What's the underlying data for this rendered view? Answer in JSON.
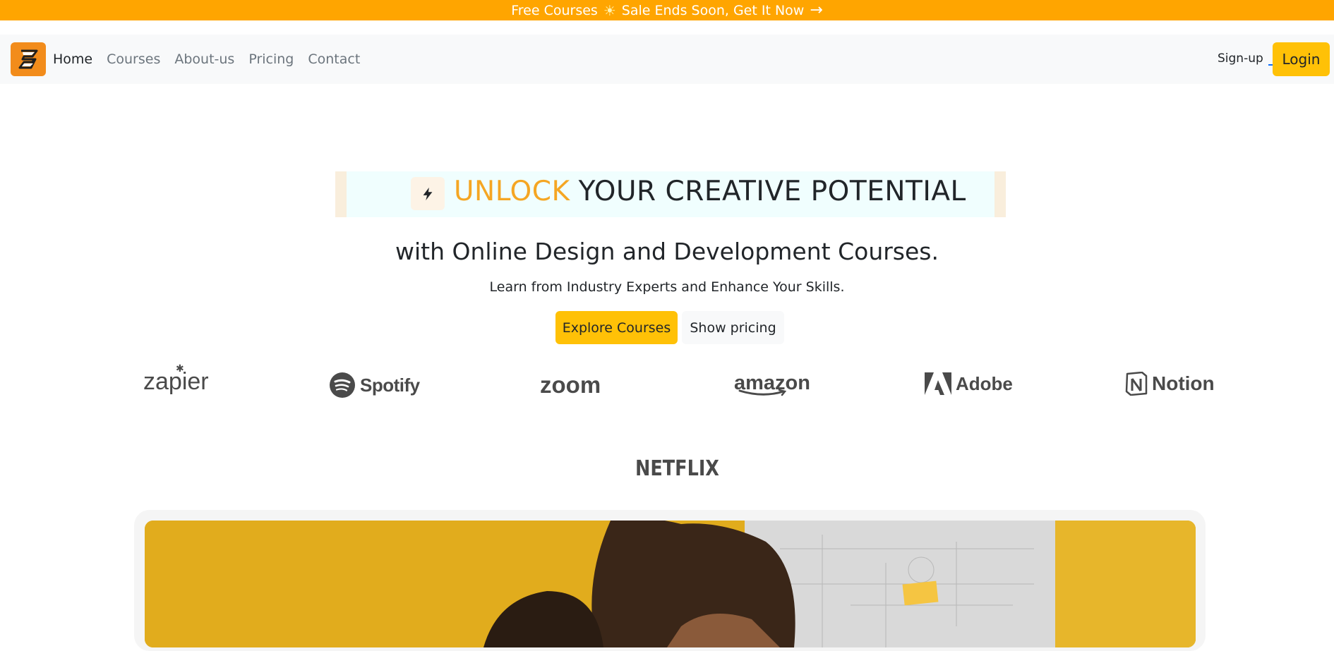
{
  "promo": {
    "part1": "Free Courses",
    "icon": "sun-icon",
    "part2": "Sale Ends Soon, Get It Now",
    "arrow_icon": "arrow-right-icon"
  },
  "navbar": {
    "logo_icon": "brand-logo-icon",
    "links": [
      "Home",
      "Courses",
      "About-us",
      "Pricing",
      "Contact"
    ],
    "active": "Home",
    "signup_label": "Sign-up",
    "login_label": "Login"
  },
  "hero": {
    "highlight": "UNLOCK",
    "headline_rest": "YOUR CREATIVE POTENTIAL",
    "subheadline": "with Online Design and Development Courses.",
    "tagline": "Learn from Industry Experts and Enhance Your Skills.",
    "primary_button": "Explore Courses",
    "secondary_button": "Show pricing",
    "bolt_icon": "lightning-bolt-icon"
  },
  "brands": [
    "zapier",
    "Spotify",
    "zoom",
    "amazon",
    "Adobe",
    "Notion",
    "NETFLIX"
  ],
  "colors": {
    "promo_bar": "#ffa500",
    "accent_button": "#ffc107",
    "highlight_text": "#f5a623",
    "nav_bg": "#f8f9fa"
  }
}
